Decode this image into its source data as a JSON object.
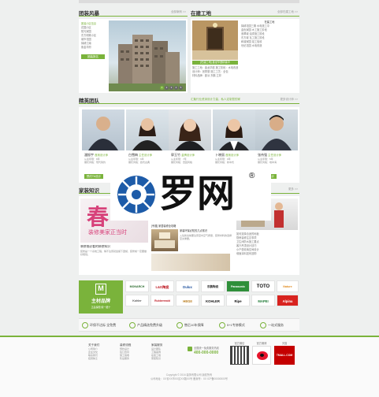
{
  "sections": {
    "tuanzhuang": {
      "title": "团装风暴",
      "more": "全部案例 >>"
    },
    "zaijian": {
      "title": "在建工地",
      "more": "全部在建工地 >>"
    },
    "team": {
      "title": "精英团队",
      "slogan": "汇聚行业资深设计力量，私人定制您的家",
      "more": "更多设计师 >>"
    },
    "knowledge": {
      "title": "家装知识",
      "more": "更多 >>"
    }
  },
  "tuan_list": {
    "heading": "团装小区信息",
    "items": [
      "花园小区",
      "阳光家园",
      "东方明珠小区",
      "城市花园",
      "锦绣江南",
      "紫金华府"
    ],
    "button": "团装报名"
  },
  "slider_dots": [
    "1",
    "2",
    "3",
    "4",
    "5"
  ],
  "site": {
    "caption": "[在建工地] 鑫龙华庭精装中",
    "desc": [
      "施工工地：鑫龙华庭 施工阶段：水电改造",
      "设计师：张秀丽 施工工艺：全包",
      "材料品牌：欧派 东鹏 立邦"
    ],
    "list_heading": "在建工地",
    "list": [
      "锦绣花园三期 水电施工中",
      "金色家园 木工施工阶段",
      "翡翠城 油漆施工阶段",
      "东方城 瓦工施工阶段",
      "和谐家园 竣工验收",
      "世纪花园 水电改造"
    ]
  },
  "designers": [
    {
      "name": "潘振宇",
      "role": "首席设计师",
      "style": "从业年限：8年",
      "cases": "擅长风格：现代简约"
    },
    {
      "name": "白雪梅",
      "role": "主任设计师",
      "style": "从业年限：6年",
      "cases": "擅长风格：欧式古典"
    },
    {
      "name": "郭玉竹",
      "role": "金牌设计师",
      "style": "从业年限：7年",
      "cases": "擅长风格：田园风格"
    },
    {
      "name": "卜晓丽",
      "role": "首席设计师",
      "style": "从业年限：9年",
      "cases": "擅长风格：新中式"
    },
    {
      "name": "张伟强",
      "role": "主任设计师",
      "style": "从业年限：5年",
      "cases": "擅长风格：地中海"
    }
  ],
  "designer_btn": "预约TA设计",
  "knowledge": {
    "banner_title": "春",
    "banner_sub": "装修美家正当时",
    "art1_title": "装修前必看的装修知识",
    "art1_text": "装修是一个系统工程，稍不注意就会留下遗憾，装修前一定要做好规划。",
    "mid_title": "[专题] 家居装修全攻略",
    "art2_title": "家装环保必知的几点常识",
    "art2_text": "入住新房前要注意室内空气质量，装修材料的选择至关重要。",
    "right_list": [
      "如何选择合适的地板",
      "厨房装修注意事项",
      "卫生间防水施工要点",
      "客厅吊顶设计技巧",
      "小户型收纳空间设计",
      "墙面涂料如何选购"
    ]
  },
  "brand_main": {
    "icon": "M",
    "title": "主材品牌",
    "sub": "正品保障 假一赔十"
  },
  "brands": [
    "MONARCH",
    "L&D陶瓷",
    "Dulux",
    "东鹏陶瓷",
    "Panasonic",
    "TOTO",
    "Nature",
    "Kohler",
    "Rubbermaid",
    "HEGII",
    "KOHLER",
    "Ripe",
    "MAPEI",
    "Alpina"
  ],
  "services": [
    "环保不达标 全免费",
    "产品精选免费升级",
    "售后10年保障",
    "5+1专修模式",
    "一站式服务"
  ],
  "footer_cols": [
    {
      "h": "关于我们",
      "items": [
        "公司简介",
        "企业文化",
        "联系我们",
        "招贤纳士"
      ]
    },
    {
      "h": "装修流程",
      "items": [
        "预约设计",
        "签订合同",
        "施工验收",
        "售后服务"
      ]
    },
    {
      "h": "家装服务",
      "items": [
        "设计团队",
        "工程案例",
        "在建工地",
        "家装知识"
      ]
    }
  ],
  "hotline": {
    "label": "全国统一免费服务热线",
    "number": "400-000-0000"
  },
  "qr_labels": [
    "官方微信",
    "官方微博",
    "天猫"
  ],
  "qr_tmall": "TMALL.COM",
  "copyright": [
    "Copyright © 2016 装饰有限公司 版权所有",
    "公司地址：XX省XX市XX区XX路XX号 备案号：XX ICP备00000000号"
  ],
  "watermark": {
    "cn": "罗网",
    "reg": "®"
  },
  "colors": {
    "accent": "#7ab33b",
    "red": "#d42b2b",
    "blue": "#1d5ba8"
  }
}
